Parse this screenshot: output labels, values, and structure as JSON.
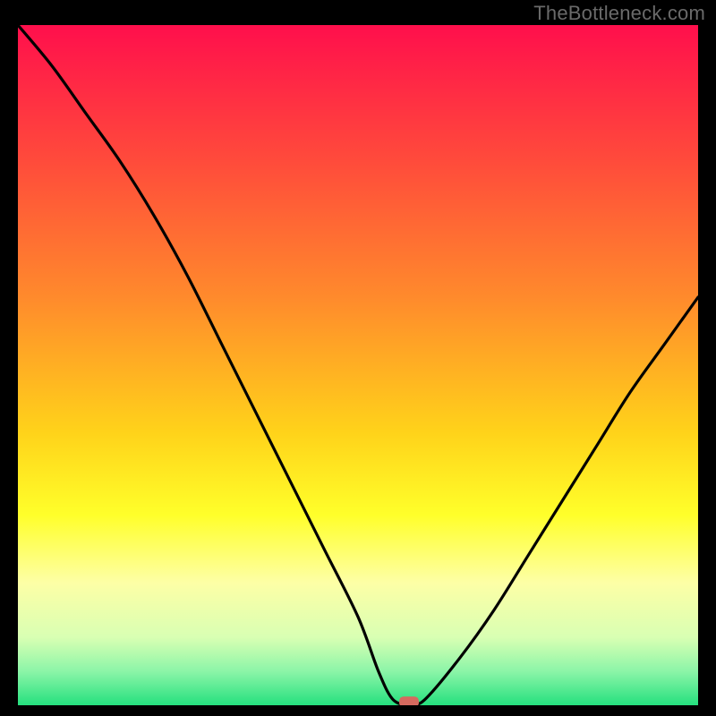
{
  "watermark": "TheBottleneck.com",
  "colors": {
    "black": "#000000",
    "curve": "#000000",
    "marker": "#d66a5f",
    "gradient_stops": [
      {
        "offset": 0.0,
        "color": "#ff0f4c"
      },
      {
        "offset": 0.2,
        "color": "#ff4b3b"
      },
      {
        "offset": 0.4,
        "color": "#ff8a2c"
      },
      {
        "offset": 0.6,
        "color": "#ffd31a"
      },
      {
        "offset": 0.72,
        "color": "#ffff2a"
      },
      {
        "offset": 0.82,
        "color": "#fdffa6"
      },
      {
        "offset": 0.9,
        "color": "#d9ffb3"
      },
      {
        "offset": 0.95,
        "color": "#8cf5a8"
      },
      {
        "offset": 1.0,
        "color": "#25e07e"
      }
    ]
  },
  "chart_data": {
    "type": "line",
    "title": "",
    "xlabel": "",
    "ylabel": "",
    "xlim": [
      0,
      100
    ],
    "ylim": [
      0,
      100
    ],
    "series": [
      {
        "name": "bottleneck-curve",
        "x": [
          0,
          5,
          10,
          15,
          20,
          25,
          30,
          35,
          40,
          45,
          50,
          53,
          55,
          57,
          58,
          60,
          65,
          70,
          75,
          80,
          85,
          90,
          95,
          100
        ],
        "y": [
          100,
          94,
          87,
          80,
          72,
          63,
          53,
          43,
          33,
          23,
          13,
          5,
          1,
          0,
          0,
          1,
          7,
          14,
          22,
          30,
          38,
          46,
          53,
          60
        ]
      }
    ],
    "marker": {
      "x": 57.5,
      "y": 0.5,
      "name": "optimal-point"
    },
    "annotations": []
  }
}
